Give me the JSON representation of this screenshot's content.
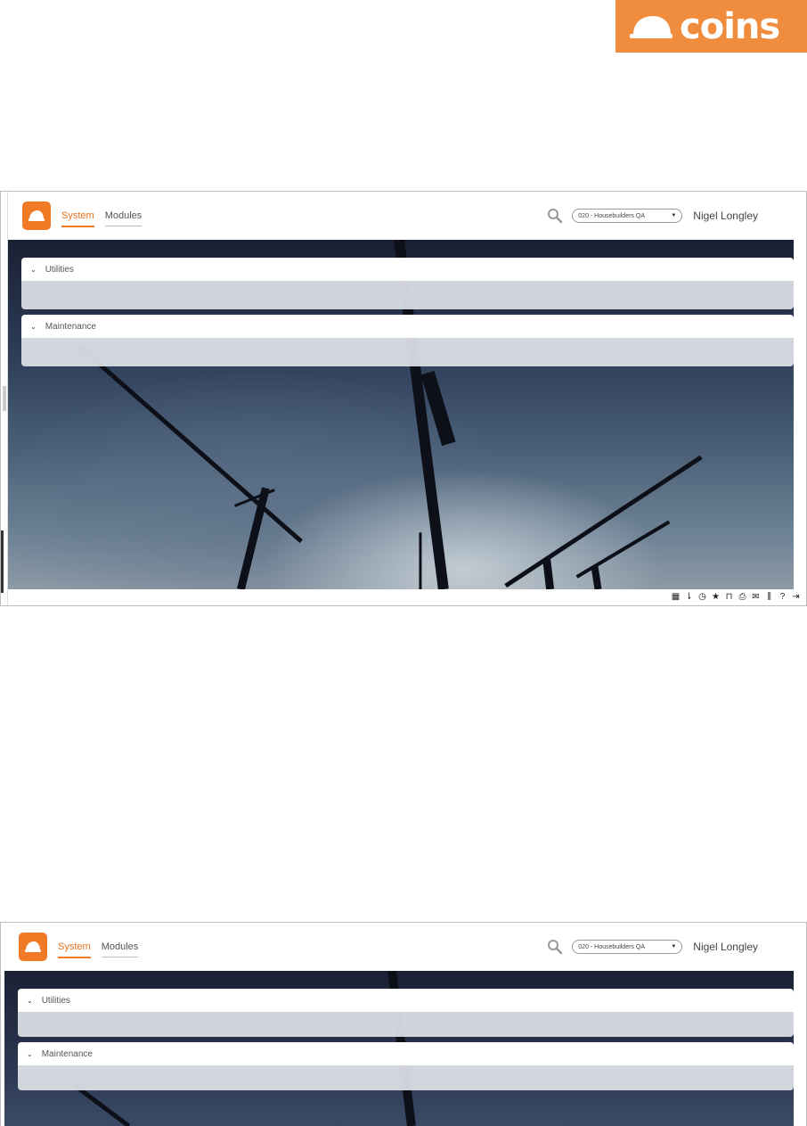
{
  "brand": {
    "text": "coins",
    "color": "#f08c3d"
  },
  "screens": [
    {
      "nav": [
        {
          "label": "System",
          "active": true
        },
        {
          "label": "Modules",
          "active": false
        }
      ],
      "company_select": {
        "value": "020 - Housebuilders QA"
      },
      "user_name": "Nigel Longley",
      "panels": [
        {
          "title": "Utilities",
          "icon": "chevron-down-icon"
        },
        {
          "title": "Maintenance",
          "icon": "chevron-down-icon"
        }
      ],
      "status_icons": [
        "grid-icon",
        "pin-icon",
        "history-icon",
        "star-icon",
        "bookmark-icon",
        "printer-icon",
        "mail-icon",
        "library-icon",
        "help-icon",
        "logout-icon"
      ]
    },
    {
      "nav": [
        {
          "label": "System",
          "active": true
        },
        {
          "label": "Modules",
          "active": false
        }
      ],
      "company_select": {
        "value": "020 - Housebuilders QA"
      },
      "user_name": "Nigel Longley",
      "panels": [
        {
          "title": "Utilities",
          "icon": "chevron-down-icon"
        },
        {
          "title": "Maintenance",
          "icon": "chevron-down-icon"
        }
      ]
    }
  ],
  "colors": {
    "accent": "#f07a26",
    "panel_body": "#dadee4"
  }
}
